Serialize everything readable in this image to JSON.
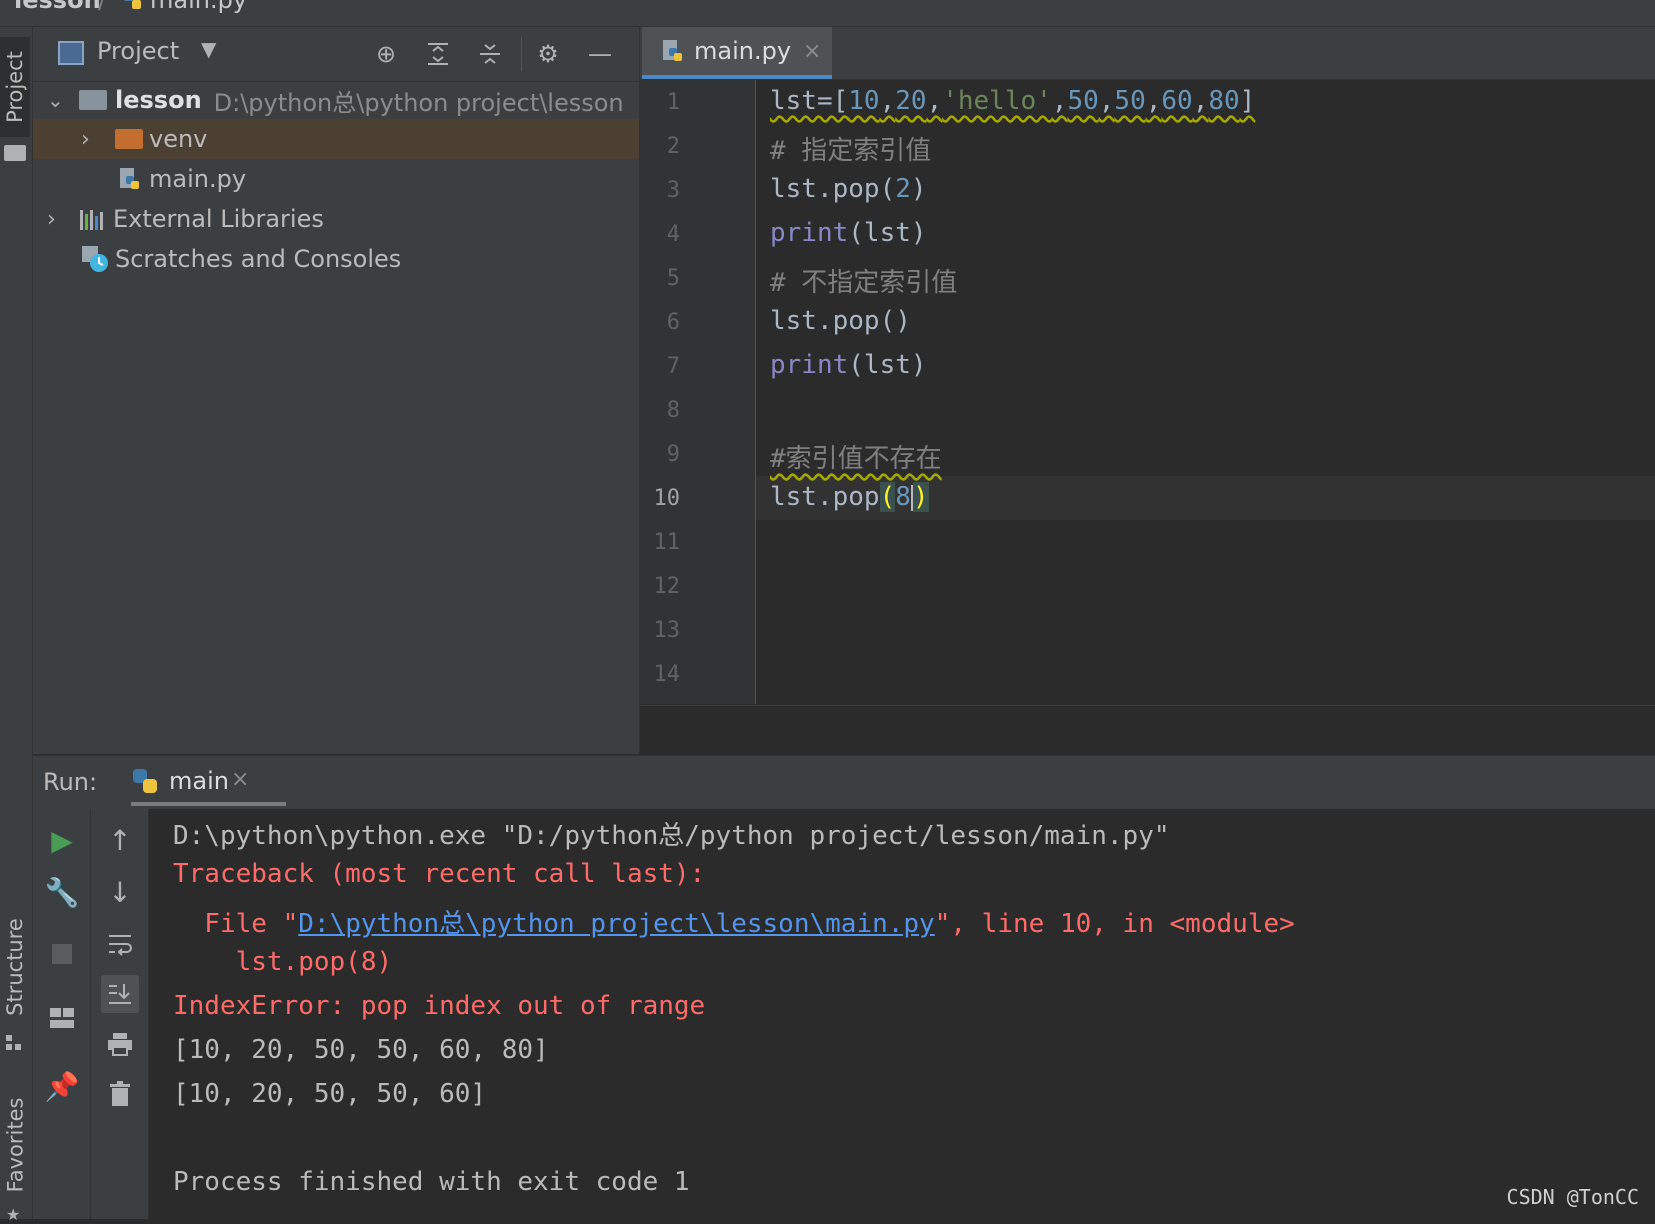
{
  "breadcrumb": {
    "project": "lesson",
    "separator": "/",
    "file": "main.py"
  },
  "left_stripe": {
    "top_tab": "Project",
    "structure_tab": "Structure",
    "favorites_tab": "Favorites"
  },
  "project_panel": {
    "title": "Project",
    "tree": [
      {
        "name": "lesson",
        "path": "D:\\python总\\python project\\lesson",
        "kind": "folder"
      },
      {
        "name": "venv",
        "kind": "folder"
      },
      {
        "name": "main.py",
        "kind": "python-file"
      },
      {
        "name": "External Libraries",
        "kind": "libraries"
      },
      {
        "name": "Scratches and Consoles",
        "kind": "scratches"
      }
    ]
  },
  "editor": {
    "tab_label": "main.py",
    "close_glyph": "×",
    "line_numbers": [
      "1",
      "2",
      "3",
      "4",
      "5",
      "6",
      "7",
      "8",
      "9",
      "10",
      "11",
      "12",
      "13",
      "14"
    ],
    "current_line": "10",
    "lines": [
      {
        "plain": "lst=[10,20,'hello',50,50,60,80]"
      },
      {
        "comment": "# 指定索引值"
      },
      {
        "a": "lst.pop(",
        "b": "2",
        "c": ")"
      },
      {
        "kw": "print",
        "rest": "(lst)"
      },
      {
        "comment": "# 不指定索引值"
      },
      {
        "a": "lst.pop()"
      },
      {
        "kw": "print",
        "rest": "(lst)"
      },
      {},
      {
        "comment": "#索引值不存在"
      },
      {
        "a": "lst.pop",
        "open": "(",
        "num": "8",
        "close": ")"
      }
    ]
  },
  "run": {
    "label": "Run:",
    "tab": "main",
    "console": {
      "cmd": "D:\\python\\python.exe \"D:/python总/python project/lesson/main.py\"",
      "traceback": "Traceback (most recent call last):",
      "file_prefix": "  File \"",
      "file_link": "D:\\python总\\python project\\lesson\\main.py",
      "file_suffix": "\", line 10, in <module>",
      "code": "    lst.pop(8)",
      "error": "IndexError: pop index out of range",
      "out1": "[10, 20, 50, 50, 60, 80]",
      "out2": "[10, 20, 50, 50, 60]",
      "exit": "Process finished with exit code 1"
    }
  },
  "watermark": "CSDN @TonCC",
  "colors": {
    "keyword": "#8888c6",
    "number": "#6897bb",
    "string": "#6a8759",
    "comment": "#808080",
    "error": "#ff6b68",
    "link": "#5394ec",
    "accent": "#4a88c7"
  }
}
